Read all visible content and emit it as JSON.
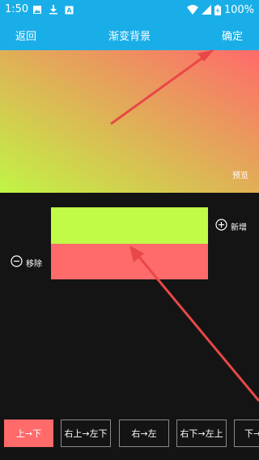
{
  "status_bar": {
    "time": "1:50",
    "battery": "100%",
    "left_icons": [
      "image-icon",
      "download-icon",
      "a-badge-icon"
    ],
    "right_icons": [
      "wifi-icon",
      "signal-icon",
      "battery-icon"
    ]
  },
  "toolbar": {
    "back_label": "返回",
    "title": "渐变背景",
    "confirm_label": "确定"
  },
  "preview": {
    "label": "预览",
    "gradient_start": "#c1f544",
    "gradient_end": "#ff6a6a"
  },
  "editor": {
    "add_label": "新增",
    "remove_label": "移除",
    "colors": [
      "#c1fb48",
      "#ff6a6a"
    ]
  },
  "directions": [
    {
      "label": "上→下",
      "active": true
    },
    {
      "label": "右上→左下",
      "active": false
    },
    {
      "label": "右→左",
      "active": false
    },
    {
      "label": "右下→左上",
      "active": false
    },
    {
      "label": "下→",
      "active": false
    }
  ],
  "colors": {
    "accent": "#1aaee8",
    "highlight": "#ff6a6a",
    "annotation_arrow": "#e84848"
  }
}
